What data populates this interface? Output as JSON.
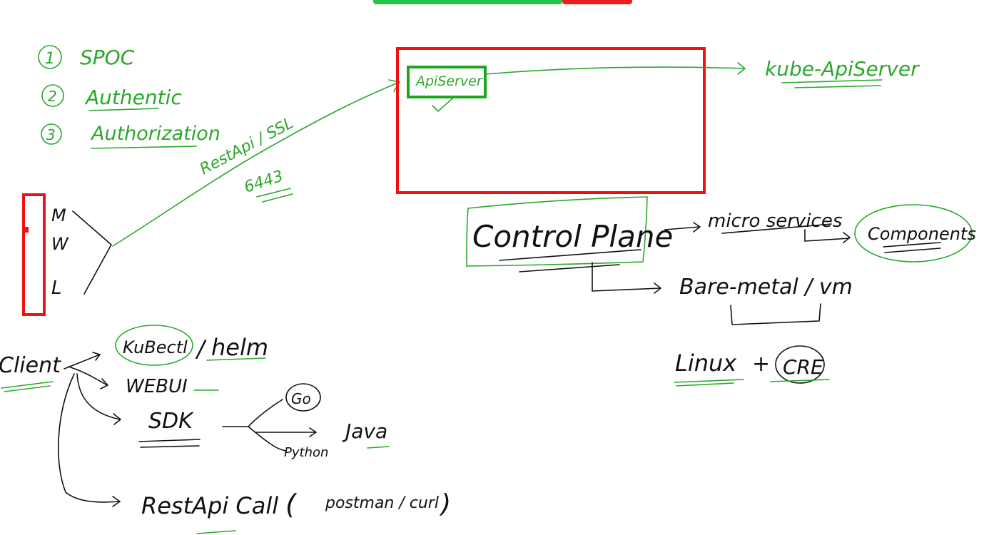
{
  "colors": {
    "green_ink": "#2aa82a",
    "black_ink": "#111111",
    "red_box": "#ee1111",
    "green_box": "#1fa51f"
  },
  "top_bar": {
    "colors": [
      "#22c44a",
      "#ee1c1c"
    ]
  },
  "numbered_list": {
    "items": [
      {
        "number": "1",
        "text": "SPOC"
      },
      {
        "number": "2",
        "text": "Authentic"
      },
      {
        "number": "3",
        "text": "Authorization"
      }
    ]
  },
  "connection": {
    "protocol_label": "RestApi / SSL",
    "port_label": "6443"
  },
  "os_list": {
    "items": [
      "M",
      "W",
      "L"
    ]
  },
  "apiserver": {
    "box_label": "ApiServer",
    "target_label": "kube-ApiServer"
  },
  "control_plane": {
    "title": "Control Plane",
    "micro_label": "micro services",
    "components_label": "Components",
    "infra_label": "Bare-metal / vm",
    "linux_label": "Linux",
    "plus": "+",
    "cre_label": "CRE"
  },
  "client": {
    "label": "Client",
    "kubectl": "KuBectl",
    "helm_sep": "/",
    "helm": "helm",
    "webui": "WEBUI",
    "sdk": "SDK",
    "go": "Go",
    "python": "Python",
    "java": "Java",
    "rest_call": "RestApi Call",
    "paren_open": "(",
    "postman": "postman / curl",
    "paren_close": ")"
  }
}
